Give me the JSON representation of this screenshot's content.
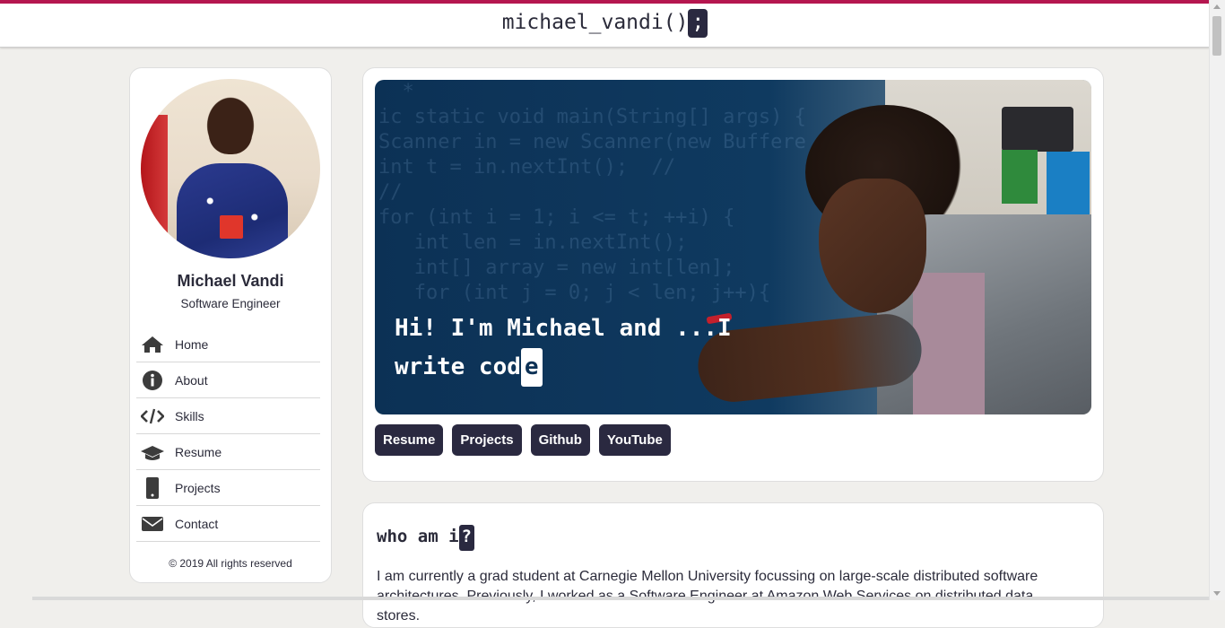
{
  "header": {
    "brand_text": "michael_vandi()",
    "brand_cursor": ";"
  },
  "profile": {
    "name": "Michael Vandi",
    "title": "Software Engineer"
  },
  "sidebar": {
    "items": [
      {
        "label": "Home",
        "icon": "home-icon"
      },
      {
        "label": "About",
        "icon": "info-icon"
      },
      {
        "label": "Skills",
        "icon": "code-icon"
      },
      {
        "label": "Resume",
        "icon": "graduation-cap-icon"
      },
      {
        "label": "Projects",
        "icon": "mobile-phone-icon"
      },
      {
        "label": "Contact",
        "icon": "envelope-icon"
      }
    ],
    "copyright": "© 2019 All rights reserved"
  },
  "hero": {
    "headline_line1": "Hi! I'm Michael and ...I",
    "headline_line2": "write cod",
    "headline_caret": "e",
    "buttons": [
      "Resume",
      "Projects",
      "Github",
      "YouTube"
    ]
  },
  "about": {
    "heading": "who am i",
    "heading_cursor": "?",
    "body": "I am currently a grad student at Carnegie Mellon University focussing on large-scale distributed software architectures. Previously, I worked as a Software Engineer at Amazon Web Services on distributed data stores."
  },
  "colors": {
    "accent": "#b5164f",
    "button_bg": "#2a2940",
    "page_bg": "#f0efec",
    "hero_bg": "#0c3155"
  }
}
